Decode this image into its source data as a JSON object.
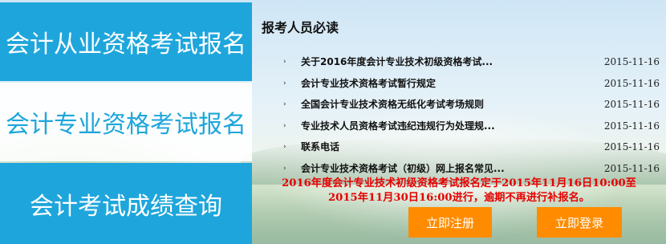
{
  "nav": {
    "tiles": [
      {
        "label": "会计从业资格考试报名"
      },
      {
        "label": "会计专业资格考试报名"
      },
      {
        "label": "会计考试成绩查询"
      }
    ]
  },
  "panel": {
    "title": "报考人员必读",
    "bullet_glyph": "›",
    "items": [
      {
        "text": "关于2016年度会计专业技术初级资格考试...",
        "date": "2015-11-16"
      },
      {
        "text": "会计专业技术资格考试暂行规定",
        "date": "2015-11-16"
      },
      {
        "text": "全国会计专业技术资格无纸化考试考场规则",
        "date": "2015-11-16"
      },
      {
        "text": "专业技术人员资格考试违纪违规行为处理规...",
        "date": "2015-11-16"
      },
      {
        "text": "联系电话",
        "date": "2015-11-16"
      },
      {
        "text": "会计专业技术资格考试（初级）网上报名常见...",
        "date": "2015-11-16"
      }
    ]
  },
  "announcement": {
    "line1": "2016年度会计专业技术初级资格考试报名定于2015年11月16日10:00至",
    "line2": "2015年11月30日16:00进行，逾期不再进行补报名。"
  },
  "actions": {
    "register_label": "立即注册",
    "login_label": "立即登录"
  },
  "colors": {
    "tile_blue": "#1ea6dc",
    "button_orange": "#ff8c00",
    "notice_red": "#e60000"
  }
}
